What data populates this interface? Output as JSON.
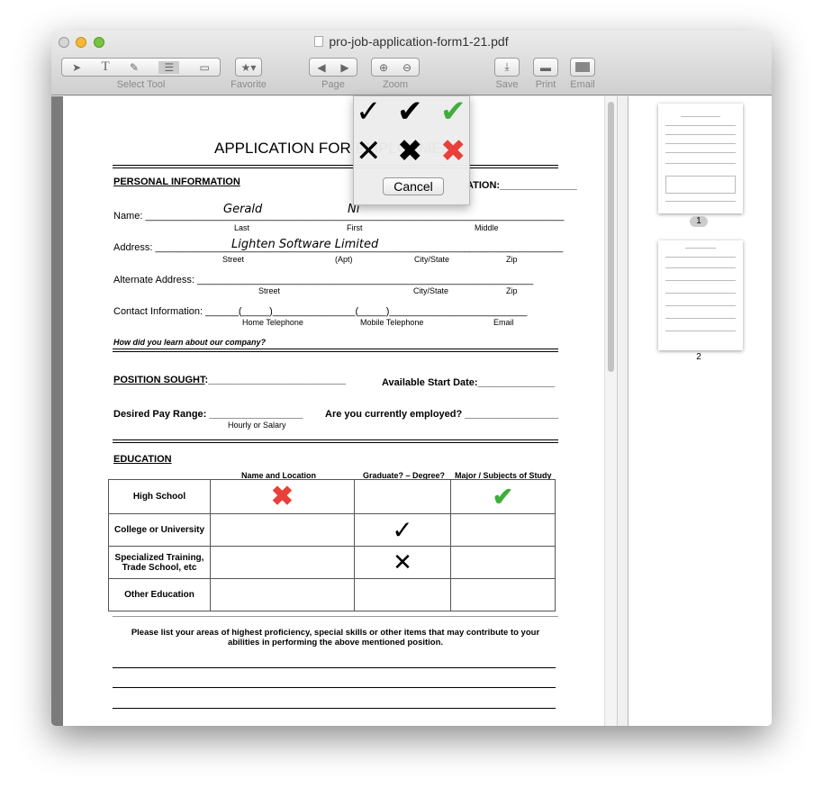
{
  "window": {
    "title": "pro-job-application-form1-21.pdf"
  },
  "toolbar": {
    "select_tool": "Select Tool",
    "favorite": "Favorite",
    "page": "Page",
    "zoom": "Zoom",
    "save": "Save",
    "print": "Print",
    "email": "Email",
    "text_glyph": "T"
  },
  "form": {
    "title": "APPLICATION FOR EMPLOYMENT",
    "personal": "PERSONAL INFORMATION",
    "position_label": "ATION:",
    "name_label": "Name:",
    "last_value": "Gerald",
    "first_value": "Ni",
    "last": "Last",
    "first": "First",
    "middle": "Middle",
    "address_label": "Address:",
    "address_value": "Lighten Software Limited",
    "street": "Street",
    "apt": "(Apt)",
    "city_state": "City/State",
    "zip": "Zip",
    "alt_address_label": "Alternate Address:",
    "contact_label": "Contact Information:",
    "home_tel": "Home Telephone",
    "mobile_tel": "Mobile Telephone",
    "email": "Email",
    "how_learn": "How did you learn about our company?",
    "position_sought": "POSITION SOUGHT",
    "start_date": "Available Start Date:",
    "pay_range": "Desired Pay Range:",
    "hourly": "Hourly or Salary",
    "employed": "Are you currently employed?",
    "education": "EDUCATION",
    "edu_cols": [
      "Name and Location",
      "Graduate? – Degree?",
      "Major / Subjects of Study"
    ],
    "edu_rows": [
      "High School",
      "College or University",
      "Specialized Training, Trade School, etc",
      "Other Education"
    ],
    "skills_text": "Please list your areas of highest proficiency, special skills or other items that may contribute to your abilities in performing the above mentioned position."
  },
  "popover": {
    "cancel": "Cancel",
    "options": [
      "check-black",
      "check-bold",
      "check-green",
      "x-black",
      "x-bold",
      "x-red"
    ]
  },
  "sidebar": {
    "pages": [
      "1",
      "2"
    ],
    "selected": "1"
  },
  "colors": {
    "green": "#3fae3a",
    "red": "#e8403a"
  }
}
